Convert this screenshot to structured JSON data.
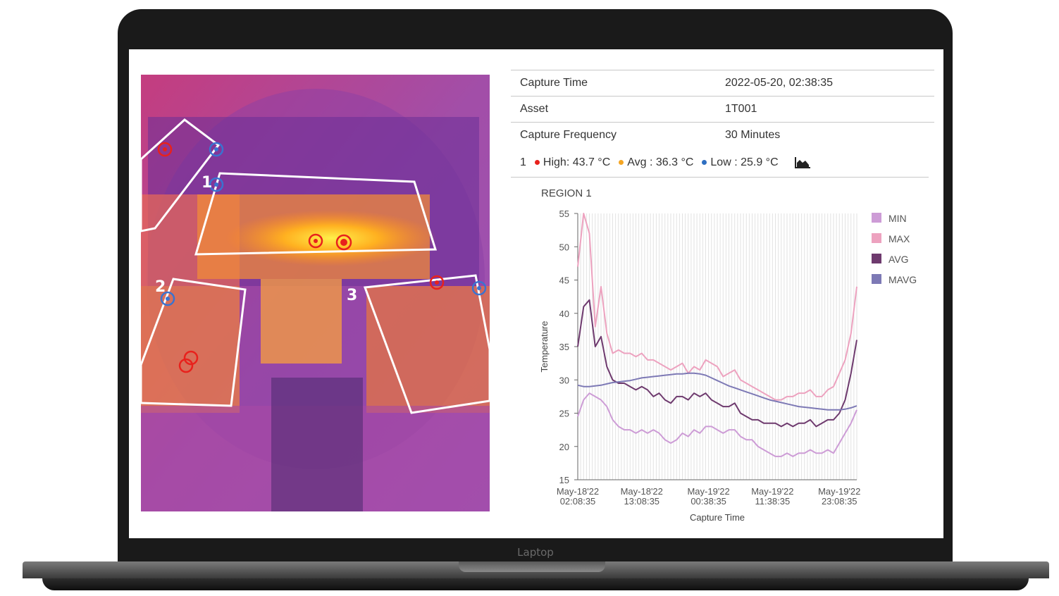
{
  "device": {
    "brand_label": "Laptop"
  },
  "thermal": {
    "region_labels": [
      "1",
      "2",
      "3"
    ]
  },
  "info_table": [
    {
      "key": "Capture Time",
      "value": "2022-05-20, 02:38:35"
    },
    {
      "key": "Asset",
      "value": "1T001"
    },
    {
      "key": "Capture Frequency",
      "value": "30 Minutes"
    }
  ],
  "stats": {
    "region_number": "1",
    "high": "High: 43.7 °C",
    "avg": "Avg : 36.3 °C",
    "low": "Low : 25.9 °C",
    "colors": {
      "high": "#e8211c",
      "avg": "#f5a623",
      "low": "#2f6fc1"
    },
    "icon": "area-chart-icon"
  },
  "chart_data": {
    "type": "line",
    "title": "REGION 1",
    "xlabel": "Capture Time",
    "ylabel": "Temperature",
    "ylim": [
      15,
      55
    ],
    "yticks": [
      15,
      20,
      25,
      30,
      35,
      40,
      45,
      50,
      55
    ],
    "x_tick_labels": [
      [
        "May-18'22",
        "02:08:35"
      ],
      [
        "May-18'22",
        "13:08:35"
      ],
      [
        "May-19'22",
        "00:38:35"
      ],
      [
        "May-19'22",
        "11:38:35"
      ],
      [
        "May-19'22",
        "23:08:35"
      ]
    ],
    "x_tick_positions": [
      0,
      22,
      45,
      67,
      90
    ],
    "x": [
      0,
      2,
      4,
      6,
      8,
      10,
      12,
      14,
      16,
      18,
      20,
      22,
      24,
      26,
      28,
      30,
      32,
      34,
      36,
      38,
      40,
      42,
      44,
      46,
      48,
      50,
      52,
      54,
      56,
      58,
      60,
      62,
      64,
      66,
      68,
      70,
      72,
      74,
      76,
      78,
      80,
      82,
      84,
      86,
      88,
      90,
      92,
      94,
      96
    ],
    "legend_position": "right",
    "series": [
      {
        "name": "MIN",
        "color": "#cd9cd6",
        "values": [
          24.5,
          27,
          28,
          27.5,
          27,
          26,
          24,
          23,
          22.5,
          22.5,
          22,
          22.5,
          22,
          22.5,
          22,
          21,
          20.5,
          21,
          22,
          21.5,
          22.5,
          22,
          23,
          23,
          22.5,
          22,
          22.5,
          22.5,
          21.5,
          21,
          21,
          20,
          19.5,
          19,
          18.5,
          18.5,
          19,
          18.5,
          19,
          19,
          19.5,
          19,
          19,
          19.5,
          19,
          20.5,
          22,
          23.5,
          25.5
        ]
      },
      {
        "name": "MAX",
        "color": "#eda2bf",
        "values": [
          47,
          55,
          52,
          38,
          44,
          37,
          34,
          34.5,
          34,
          34,
          33.5,
          34,
          33,
          33,
          32.5,
          32,
          31.5,
          32,
          32.5,
          31,
          32,
          31.5,
          33,
          32.5,
          32,
          30.5,
          31,
          31.5,
          30,
          29.5,
          29,
          28.5,
          28,
          27.5,
          27,
          27,
          27.5,
          27.5,
          28,
          28,
          28.5,
          27.5,
          27.5,
          28.5,
          29,
          31,
          33,
          37,
          44
        ]
      },
      {
        "name": "AVG",
        "color": "#6e3a6e",
        "values": [
          35,
          41,
          42,
          35,
          36.5,
          32,
          30,
          29.5,
          29.5,
          29,
          28.5,
          29,
          28.5,
          27.5,
          28,
          27,
          26.5,
          27.5,
          27.5,
          27,
          28,
          27.5,
          28,
          27,
          26.5,
          26,
          26,
          26.5,
          25,
          24.5,
          24,
          24,
          23.5,
          23.5,
          23.5,
          23,
          23.5,
          23,
          23.5,
          23.5,
          24,
          23,
          23.5,
          24,
          24,
          25,
          27,
          31,
          36
        ]
      },
      {
        "name": "MAVG",
        "color": "#7d79b5",
        "values": [
          29.2,
          29,
          29,
          29.1,
          29.2,
          29.4,
          29.6,
          29.7,
          29.8,
          29.9,
          30.1,
          30.3,
          30.4,
          30.5,
          30.6,
          30.7,
          30.8,
          30.9,
          30.9,
          31,
          31,
          30.9,
          30.7,
          30.3,
          29.9,
          29.5,
          29.1,
          28.8,
          28.5,
          28.2,
          27.9,
          27.6,
          27.3,
          27,
          26.8,
          26.6,
          26.4,
          26.2,
          26,
          25.9,
          25.8,
          25.7,
          25.6,
          25.5,
          25.5,
          25.5,
          25.6,
          25.8,
          26.1
        ]
      }
    ]
  }
}
